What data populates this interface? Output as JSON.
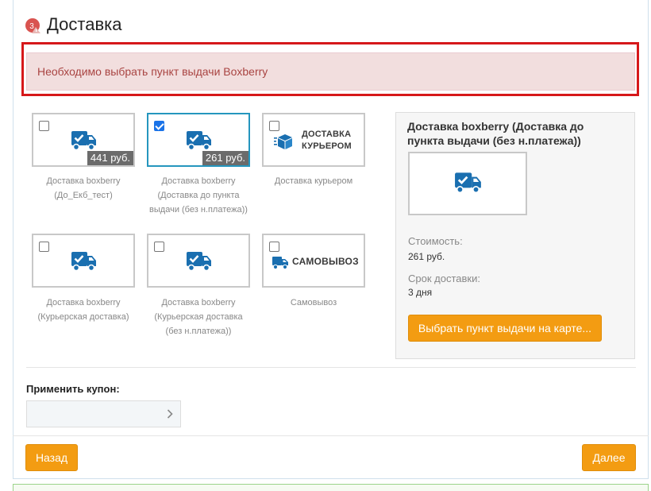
{
  "header": {
    "step_badge": "3",
    "title": "Доставка"
  },
  "alert": {
    "message": "Необходимо выбрать пункт выдачи Boxberry"
  },
  "options": [
    {
      "price": "441 руб.",
      "checked": false,
      "caption_lines": [
        "Доставка boxberry",
        "(До_Екб_тест)"
      ]
    },
    {
      "price": "261 руб.",
      "checked": true,
      "caption_lines": [
        "Доставка boxberry",
        "(Доставка до пункта",
        "выдачи (без н.платежа))"
      ]
    },
    {
      "brand_lines": [
        "ДОСТАВКА",
        "КУРЬЕРОМ"
      ],
      "checked": false,
      "caption_lines": [
        "Доставка курьером"
      ]
    },
    {
      "checked": false,
      "caption_lines": [
        "Доставка boxberry",
        "(Курьерская доставка)"
      ]
    },
    {
      "checked": false,
      "caption_lines": [
        "Доставка boxberry",
        "(Курьерская доставка",
        "(без н.платежа))"
      ]
    },
    {
      "brand_lines": [
        "САМОВЫВОЗ"
      ],
      "checked": false,
      "caption_lines": [
        "Самовывоз"
      ]
    }
  ],
  "details": {
    "title": "Доставка boxberry (Доставка до пункта выдачи (без н.платежа))",
    "cost_label": "Стоимость:",
    "cost_value": "261 руб.",
    "term_label": "Срок доставки:",
    "term_value": "3 дня",
    "map_button": "Выбрать пункт выдачи на карте..."
  },
  "coupon": {
    "label": "Применить купон:",
    "value": ""
  },
  "footer": {
    "back_button": "Назад",
    "next_button": "Далее"
  },
  "colors": {
    "accent": "#f39c12",
    "truck": "#1a6fb0",
    "alert_border": "#d6181a",
    "alert_bg": "#f2dede",
    "alert_text": "#a94442",
    "selected_border": "#2596be"
  }
}
